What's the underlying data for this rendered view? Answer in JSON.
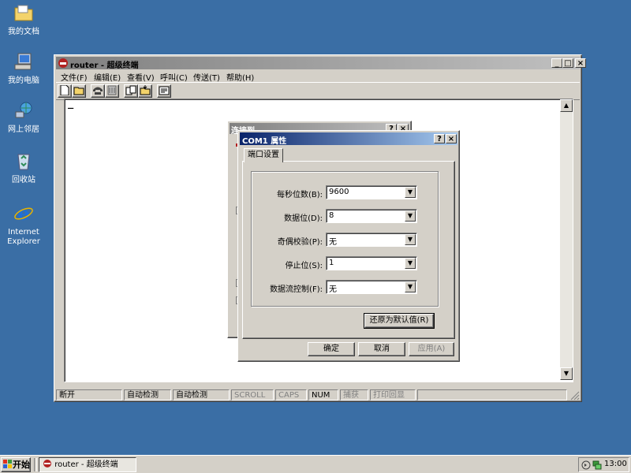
{
  "desktop": {
    "icons": [
      {
        "label": "我的文档"
      },
      {
        "label": "我的电脑"
      },
      {
        "label": "网上邻居"
      },
      {
        "label": "回收站"
      },
      {
        "label": "Internet Explorer"
      }
    ]
  },
  "window": {
    "title": "router - 超级终端",
    "menu": [
      "文件(F)",
      "编辑(E)",
      "查看(V)",
      "呼叫(C)",
      "传送(T)",
      "帮助(H)"
    ],
    "cursor": "_",
    "status": [
      "断开",
      "自动检测",
      "自动检测",
      "SCROLL",
      "CAPS",
      "NUM",
      "捕获",
      "打印回显"
    ]
  },
  "back_dialog": {
    "title": "连接到"
  },
  "dialog": {
    "title": "COM1 属性",
    "tab": "端口设置",
    "fields": [
      {
        "label": "每秒位数(B):",
        "value": "9600"
      },
      {
        "label": "数据位(D):",
        "value": "8"
      },
      {
        "label": "奇偶校验(P):",
        "value": "无"
      },
      {
        "label": "停止位(S):",
        "value": "1"
      },
      {
        "label": "数据流控制(F):",
        "value": "无"
      }
    ],
    "restore_label": "还原为默认值(R)",
    "ok_label": "确定",
    "cancel_label": "取消",
    "apply_label": "应用(A)"
  },
  "taskbar": {
    "start_label": "开始",
    "task_label": "router - 超级终端",
    "clock": "13:00"
  }
}
